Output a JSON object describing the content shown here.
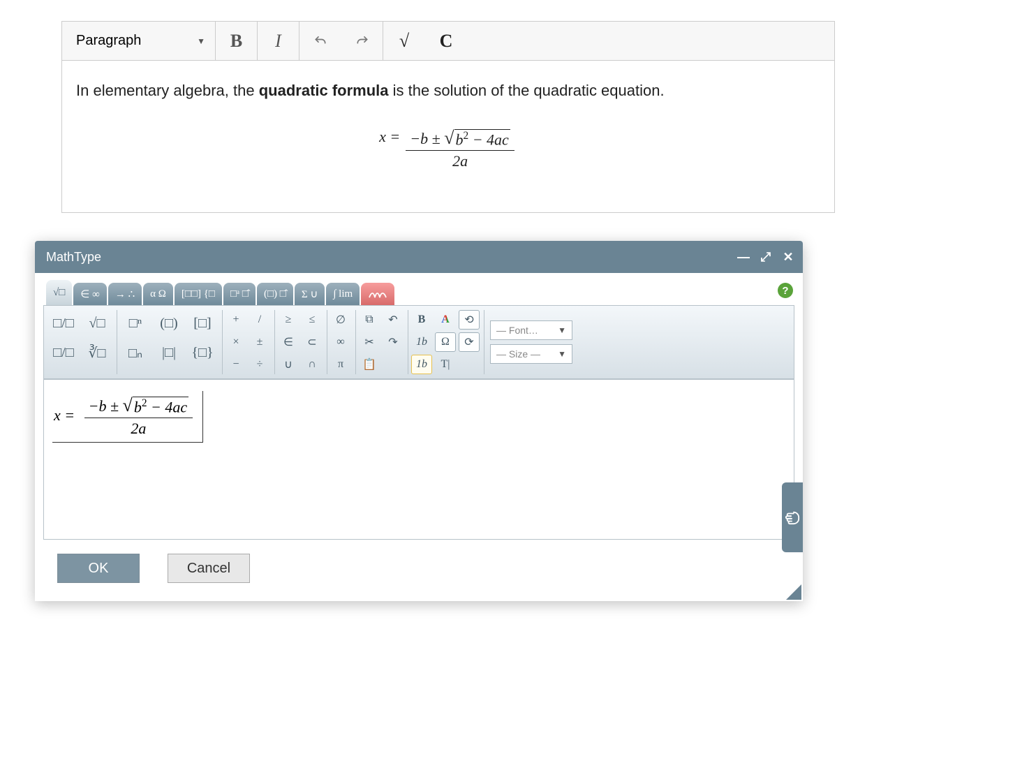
{
  "editor": {
    "format_select": "Paragraph",
    "toolbar": {
      "bold": "B",
      "italic": "I",
      "math_tool": "√",
      "chem_tool": "C"
    },
    "content": {
      "text_before_bold": "In elementary algebra, the ",
      "bold_phrase": "quadratic formula",
      "text_after_bold": " is the solution of the quadratic equation.",
      "formula": {
        "lhs": "x =",
        "numerator_prefix": "−b ±",
        "sqrt_arg_base": "b",
        "sqrt_arg_exp": "2",
        "sqrt_arg_rest": " − 4ac",
        "denominator": "2a"
      }
    }
  },
  "dialog": {
    "title": "MathType",
    "help": "?",
    "tabs": {
      "t0": "√□ ",
      "t0b": "□/□",
      "t1": "∈ ∞",
      "t2": "→ ∴",
      "t3": "α Ω",
      "t4": "[□□] {□",
      "t5": "□ᵃ □̂",
      "t6": "(□) □̂",
      "t7": "Σ ∪",
      "t8": "∫ lim"
    },
    "palette": {
      "g1": {
        "a": "□/□",
        "b": "√□",
        "c": "□/□",
        "d": "∛□"
      },
      "g2": {
        "a": "□ⁿ",
        "b": "(□)",
        "c": "[□]",
        "d": "□ₙ",
        "e": "|□|",
        "f": "{□}"
      },
      "g3": {
        "a": "+",
        "b": "/",
        "c": "×",
        "d": "±",
        "e": "−",
        "f": "÷"
      },
      "g4": {
        "a": "≥",
        "b": "≤",
        "c": "∈",
        "d": "⊂",
        "e": "∪",
        "f": "∩"
      },
      "g5": {
        "a": "∅",
        "b": "∞",
        "c": "π"
      },
      "g6": {
        "copy": "⧉",
        "undo": "↶",
        "cut": "✂",
        "redo": "↷",
        "paste": "📋"
      },
      "g7": {
        "bold": "B",
        "colorA": "A",
        "rtl": "⟲",
        "font": "1b",
        "omega": "Ω",
        "ltr": "⟳",
        "font2": "1b",
        "ti": "T|"
      },
      "font_selector": "— Font…",
      "size_selector": "— Size —"
    },
    "canvas_formula": {
      "lhs": "x =",
      "numerator_prefix": "−b ±",
      "sqrt_arg_base": "b",
      "sqrt_arg_exp": "2",
      "sqrt_arg_rest": " − 4ac",
      "denominator": "2a"
    },
    "footer": {
      "ok": "OK",
      "cancel": "Cancel"
    }
  }
}
